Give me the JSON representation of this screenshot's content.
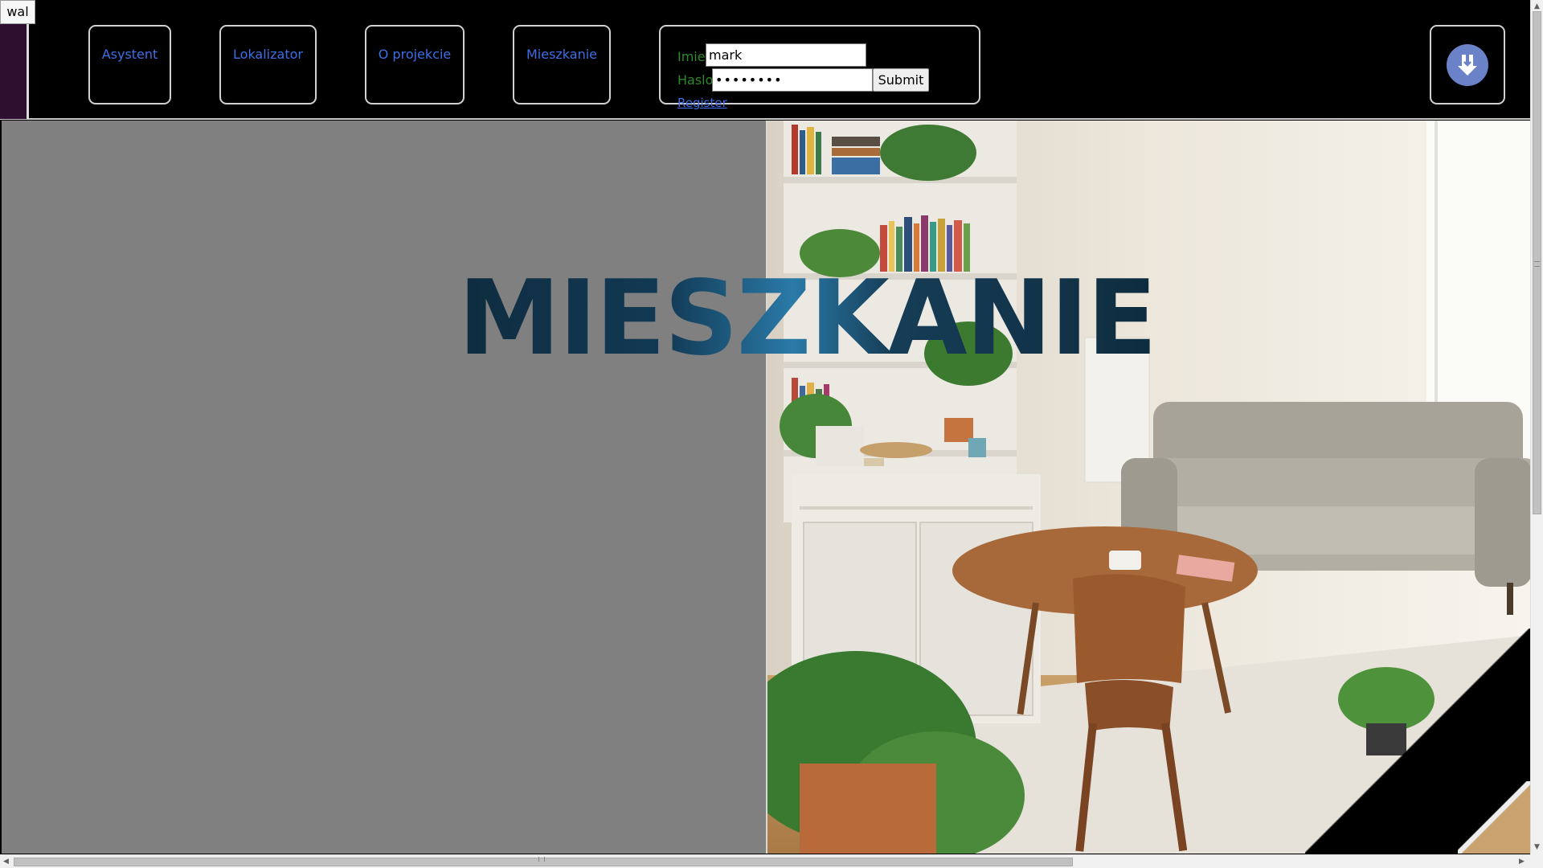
{
  "top_button": {
    "label": "wal"
  },
  "nav": {
    "items": [
      {
        "label": "Asystent"
      },
      {
        "label": "Lokalizator"
      },
      {
        "label": "O projekcie"
      },
      {
        "label": "Mieszkanie"
      }
    ]
  },
  "login": {
    "name_label": "Imie",
    "name_value": "mark",
    "password_label": "Haslo",
    "password_value": "••••••••",
    "submit_label": "Submit",
    "register_label": "Register"
  },
  "hero": {
    "title": "MIESZKANIE"
  },
  "colors": {
    "nav_link": "#3e6fe6",
    "login_label": "#2f8a2a",
    "avatar": "#6a82c8",
    "panel_gray": "#808080"
  },
  "icons": {
    "avatar": "download-shield-icon"
  }
}
